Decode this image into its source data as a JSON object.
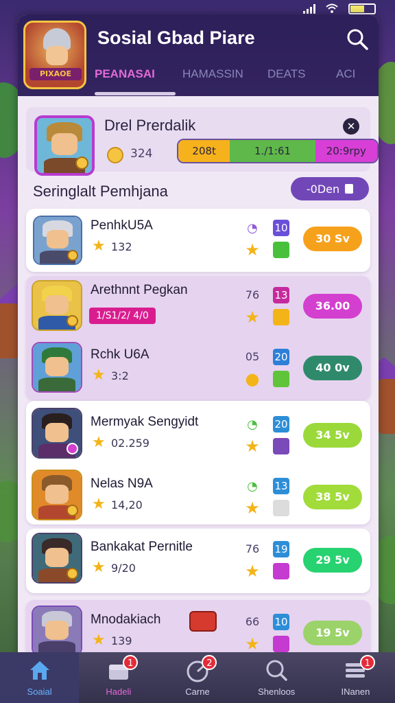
{
  "statusbar": {
    "signal_icon": "signal-icon",
    "wifi_icon": "wifi-icon",
    "battery_icon": "battery-icon"
  },
  "header": {
    "title": "Sosial Gbad Piare",
    "logo_text": "PIXAOE",
    "search_icon": "search-icon",
    "tabs": [
      {
        "label": "PEANASAI",
        "active": true
      },
      {
        "label": "HAMASSIN",
        "active": false
      },
      {
        "label": "DEATS",
        "active": false
      },
      {
        "label": "ACI",
        "active": false
      }
    ]
  },
  "featured": {
    "name": "Drel Prerdalik",
    "coins": "324",
    "close_icon": "close-icon",
    "progress": [
      {
        "label": "208t",
        "color": "#f6b21c",
        "weight": 1.0
      },
      {
        "label": "1./1:61",
        "color": "#5fb84a",
        "weight": 1.65
      },
      {
        "label": "20:9rpy",
        "color": "#d83fd6",
        "weight": 1.2
      }
    ]
  },
  "section": {
    "title": "Seringlalt Pemhjana",
    "filter_label": "-0Den",
    "filter_icon": "clipboard-icon"
  },
  "players": [
    {
      "name": "PenhkU5A",
      "score": "132",
      "stat1": "",
      "stat2": "10",
      "pill": "30 Sv",
      "pill_color": "#f6a11c"
    },
    {
      "name": "Arethnnt Pegkan",
      "tag": "1/S1/2/ 4/0",
      "stat1": "76",
      "stat2": "13",
      "pill": "36.00",
      "pill_color": "#d33fcf"
    },
    {
      "name": "Rchk U6A",
      "score": "3:2",
      "stat1": "05",
      "stat2": "20",
      "pill": "40 0v",
      "pill_color": "#2f8a6c"
    },
    {
      "name": "Mermyak Sengyidt",
      "score": "02.259",
      "stat1": "",
      "stat2": "20",
      "pill": "34 5v",
      "pill_color": "#9bd93a"
    },
    {
      "name": "Nelas N9A",
      "score": "14,20",
      "stat1": "",
      "stat2": "13",
      "pill": "38 5v",
      "pill_color": "#a2dc3b"
    },
    {
      "name": "Bankakat Pernitle",
      "score": "9/20",
      "stat1": "76",
      "stat2": "19",
      "pill": "29 5v",
      "pill_color": "#27d270"
    },
    {
      "name": "Mnodakiach",
      "score": "139",
      "stat1": "66",
      "stat2": "10",
      "pill": "19 5v",
      "pill_color": "#9bd36a"
    }
  ],
  "nav": [
    {
      "label": "Soaial",
      "icon": "home-icon",
      "badge": "",
      "active": true
    },
    {
      "label": "Hadeli",
      "icon": "chest-icon",
      "badge": "1",
      "active": false
    },
    {
      "label": "Carne",
      "icon": "gauge-icon",
      "badge": "2",
      "active": false
    },
    {
      "label": "Shenloos",
      "icon": "search-icon",
      "badge": "",
      "active": false
    },
    {
      "label": "INanen",
      "icon": "menu-icon",
      "badge": "1",
      "active": false
    }
  ]
}
